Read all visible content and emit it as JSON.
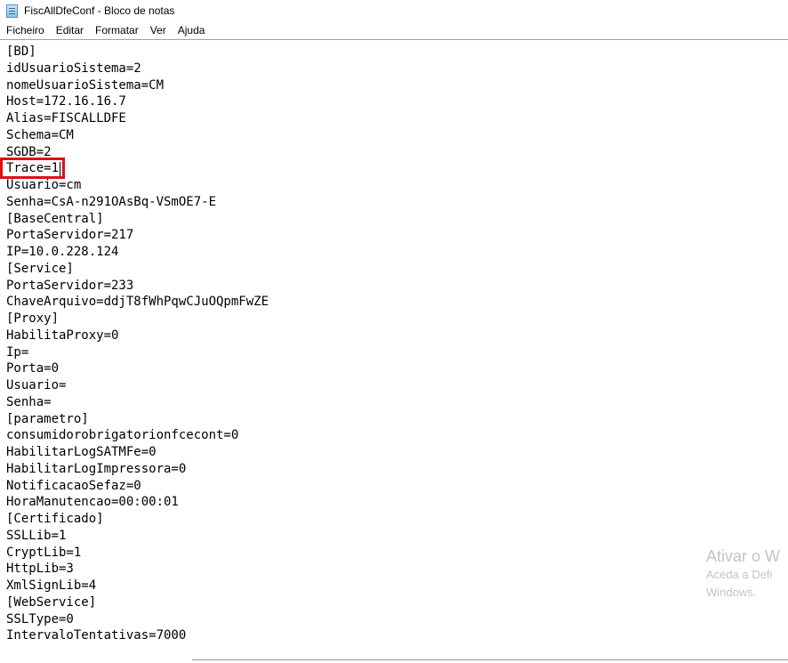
{
  "window": {
    "title": "FiscAllDfeConf - Bloco de notas"
  },
  "menu": {
    "items": [
      "Ficheiro",
      "Editar",
      "Formatar",
      "Ver",
      "Ajuda"
    ]
  },
  "editor": {
    "lines": [
      "[BD]",
      "idUsuarioSistema=2",
      "nomeUsuarioSistema=CM",
      "Host=172.16.16.7",
      "Alias=FISCALLDFE",
      "Schema=CM",
      "SGDB=2",
      "Trace=1",
      "Usuario=cm",
      "Senha=CsA-n291OAsBq-VSmOE7-E",
      "[BaseCentral]",
      "PortaServidor=217",
      "IP=10.0.228.124",
      "[Service]",
      "PortaServidor=233",
      "ChaveArquivo=ddjT8fWhPqwCJuOQpmFwZE",
      "[Proxy]",
      "HabilitaProxy=0",
      "Ip=",
      "Porta=0",
      "Usuario=",
      "Senha=",
      "[parametro]",
      "consumidorobrigatorionfcecont=0",
      "HabilitarLogSATMFe=0",
      "HabilitarLogImpressora=0",
      "NotificacaoSefaz=0",
      "HoraManutencao=00:00:01",
      "[Certificado]",
      "SSLLib=1",
      "CryptLib=1",
      "HttpLib=3",
      "XmlSignLib=4",
      "[WebService]",
      "SSLType=0",
      "IntervaloTentativas=7000"
    ]
  },
  "watermark": {
    "title": "Ativar o W",
    "line1": "Aceda a Defi",
    "line2": "Windows."
  },
  "colors": {
    "highlight": "#e01010",
    "watermark": "#c4c4c4"
  }
}
